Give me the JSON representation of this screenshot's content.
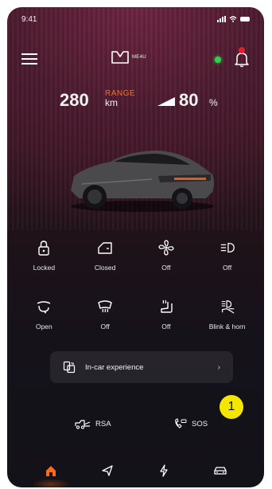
{
  "status_bar": {
    "time": "9:41"
  },
  "header": {
    "logo_text": "ME4U"
  },
  "stats": {
    "range_value": "280",
    "range_label": "RANGE",
    "range_unit": "km",
    "battery_value": "80",
    "battery_unit": "%"
  },
  "controls_row1": [
    {
      "icon": "lock-icon",
      "label": "Locked"
    },
    {
      "icon": "car-door-icon",
      "label": "Closed"
    },
    {
      "icon": "fan-icon",
      "label": "Off"
    },
    {
      "icon": "headlight-icon",
      "label": "Off"
    }
  ],
  "controls_row2": [
    {
      "icon": "sunroof-icon",
      "label": "Open"
    },
    {
      "icon": "defrost-icon",
      "label": "Off"
    },
    {
      "icon": "seat-heat-icon",
      "label": "Off"
    },
    {
      "icon": "blink-horn-icon",
      "label": "Blink & horn"
    }
  ],
  "incar": {
    "label": "In-car experience",
    "chevron": "›"
  },
  "quick": {
    "rsa_label": "RSA",
    "sos_label": "SOS"
  },
  "marker": {
    "label": "1"
  },
  "colors": {
    "accent": "#ff6a1a",
    "online": "#2fd24a",
    "marker": "#f5e600",
    "badge": "#e41e2c"
  }
}
